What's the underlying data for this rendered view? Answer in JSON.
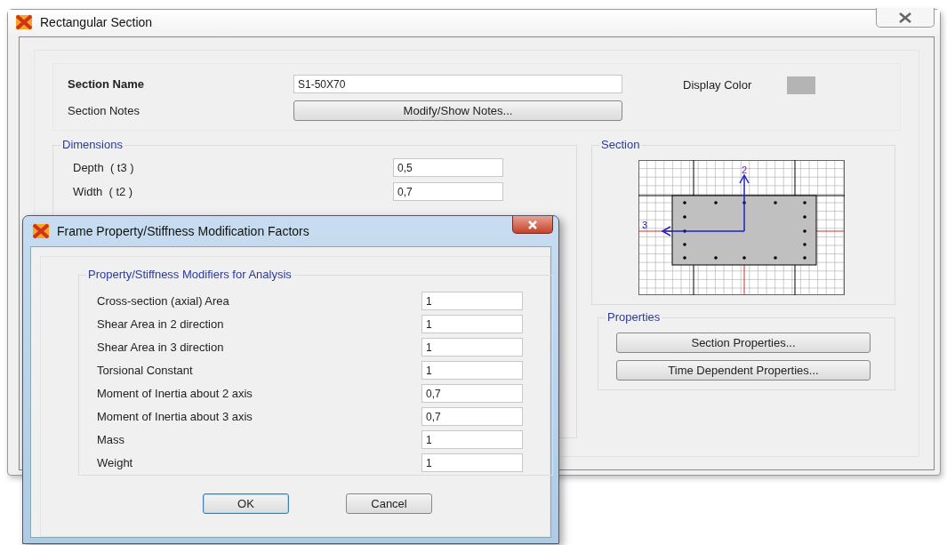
{
  "window": {
    "title": "Rectangular Section"
  },
  "section_name": {
    "label": "Section Name",
    "value": "S1-50X70"
  },
  "section_notes": {
    "label": "Section Notes",
    "button": "Modify/Show Notes..."
  },
  "display_color": {
    "label": "Display Color",
    "color": "#b4b4b4"
  },
  "dimensions": {
    "title": "Dimensions",
    "fields": [
      {
        "label": "Depth  ( t3 )",
        "value": "0,5"
      },
      {
        "label": "Width  ( t2 )",
        "value": "0,7"
      }
    ]
  },
  "section_preview": {
    "title": "Section",
    "axis_labels": [
      "2",
      "3"
    ]
  },
  "properties": {
    "title": "Properties",
    "buttons": [
      "Section Properties...",
      "Time Dependent Properties..."
    ]
  },
  "dialog": {
    "title": "Frame Property/Stiffness Modification Factors",
    "group_title": "Property/Stiffness Modifiers for Analysis",
    "modifiers": [
      {
        "label": "Cross-section (axial) Area",
        "value": "1"
      },
      {
        "label": "Shear Area in 2 direction",
        "value": "1"
      },
      {
        "label": "Shear Area in 3 direction",
        "value": "1"
      },
      {
        "label": "Torsional Constant",
        "value": "1"
      },
      {
        "label": "Moment of Inertia about 2 axis",
        "value": "0,7"
      },
      {
        "label": "Moment of Inertia about 3 axis",
        "value": "0,7"
      },
      {
        "label": "Mass",
        "value": "1"
      },
      {
        "label": "Weight",
        "value": "1"
      }
    ],
    "buttons": [
      {
        "label": "OK",
        "default": true
      },
      {
        "label": "Cancel",
        "default": false
      }
    ]
  }
}
